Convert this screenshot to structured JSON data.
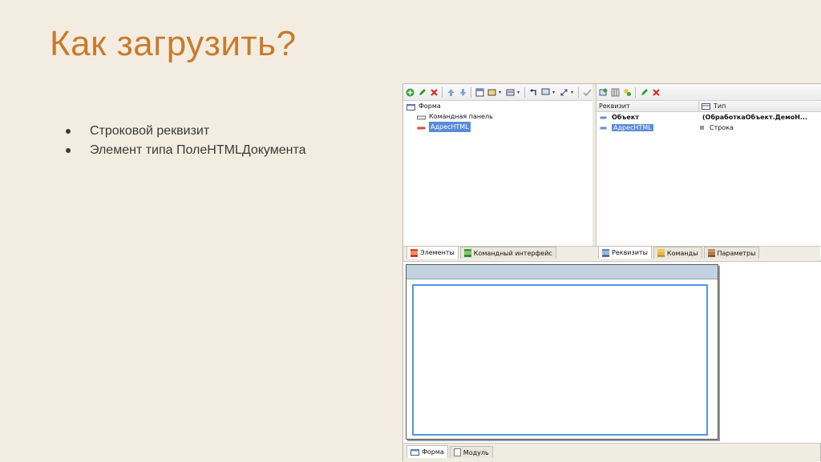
{
  "slide": {
    "title": "Как загрузить?",
    "bullets": [
      "Строковой реквизит",
      "Элемент типа ПолеHTMLДокумента"
    ]
  },
  "elements_panel": {
    "tree": [
      {
        "label": "Форма",
        "icon": "form-icon"
      },
      {
        "label": "Командная панель",
        "icon": "command-bar-icon"
      },
      {
        "label": "АдресHTML",
        "icon": "field-icon",
        "selected": true
      }
    ],
    "tabs": [
      {
        "label": "Элементы",
        "active": true,
        "icon": "elements-icon"
      },
      {
        "label": "Командный интерфейс",
        "active": false,
        "icon": "command-interface-icon"
      }
    ]
  },
  "attributes_panel": {
    "columns": [
      "Реквизит",
      "Тип"
    ],
    "rows": [
      {
        "name": "Объект",
        "type": "(ОбработкаОбъект.ДемоН...",
        "bold": true
      },
      {
        "name": "АдресHTML",
        "type": "Строка",
        "selected": true
      }
    ],
    "tabs": [
      {
        "label": "Реквизиты",
        "active": true
      },
      {
        "label": "Команды",
        "active": false
      },
      {
        "label": "Параметры",
        "active": false
      }
    ]
  },
  "bottom_tabs": [
    {
      "label": "Форма",
      "active": true
    },
    {
      "label": "Модуль",
      "active": false
    }
  ],
  "colors": {
    "title": "#c87b2c",
    "background": "#f3ede1",
    "selection": "#5b8bd6",
    "html_field_border": "#4f95e0"
  }
}
